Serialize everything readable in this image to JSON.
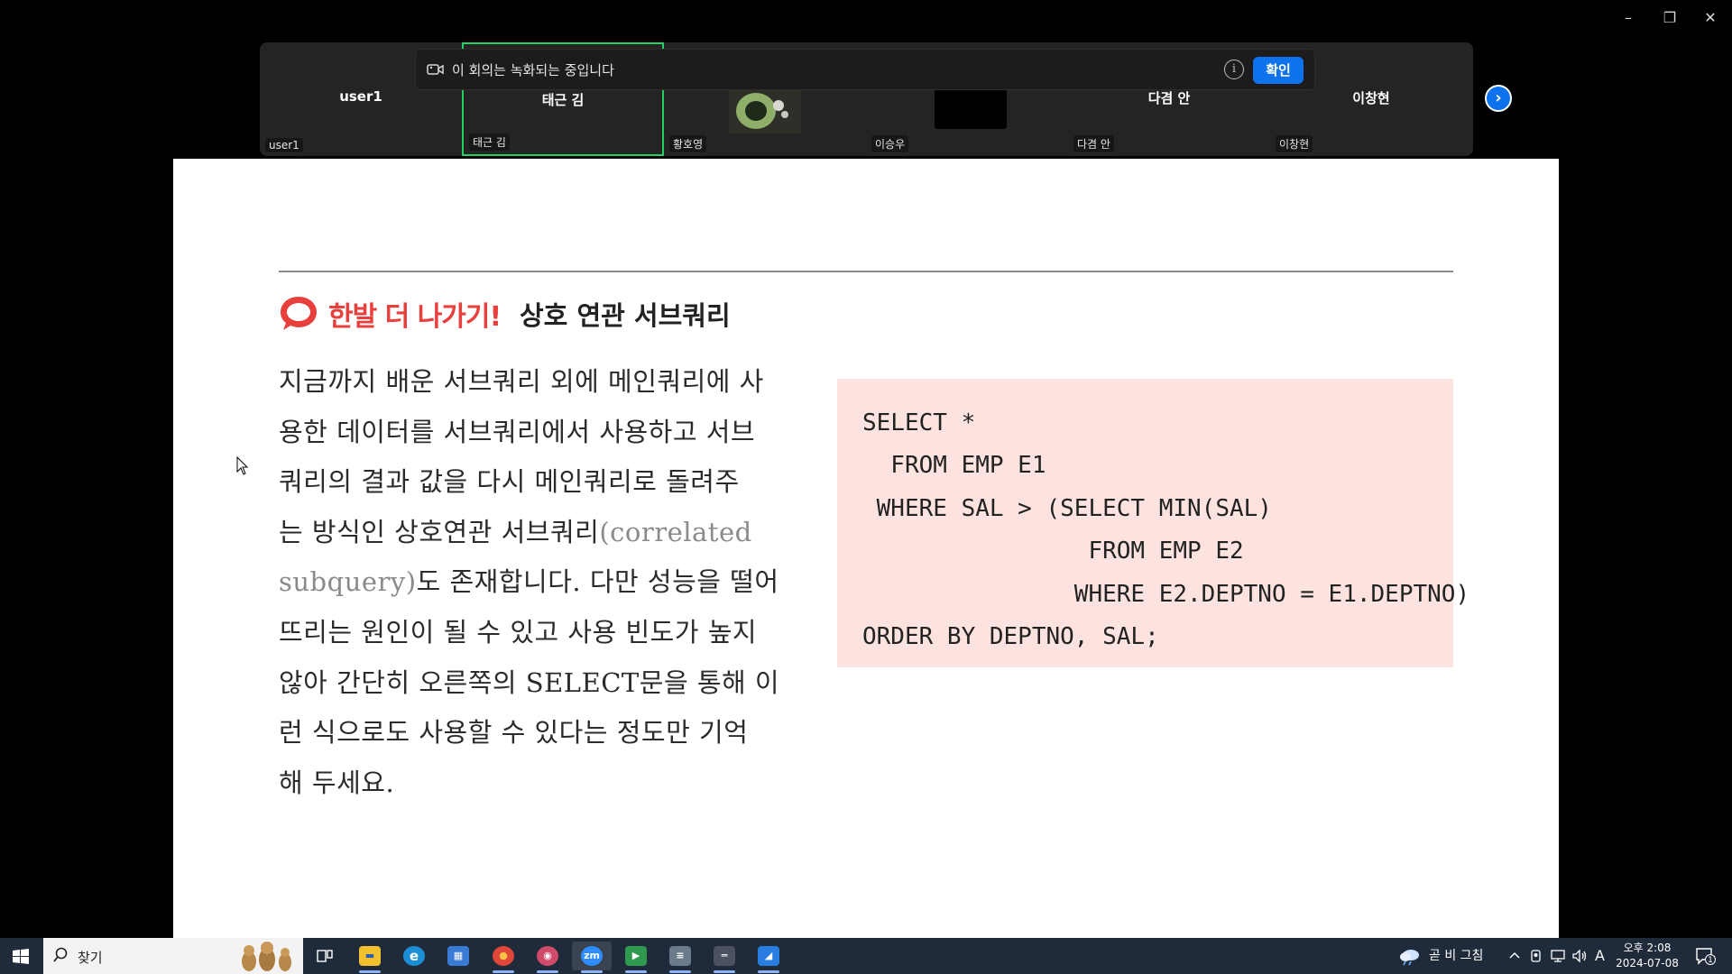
{
  "window": {
    "minimize": "–",
    "restore": "❐",
    "close": "✕"
  },
  "banner": {
    "message": "이 회의는 녹화되는 중입니다",
    "info": "i",
    "confirm": "확인"
  },
  "participants": [
    {
      "big": "user1",
      "small": "user1"
    },
    {
      "big": "태근 김",
      "small": "태근 김"
    },
    {
      "big": "",
      "small": "황호영"
    },
    {
      "big": "",
      "small": "이승우"
    },
    {
      "big": "다겸 안",
      "small": "다겸 안"
    },
    {
      "big": "이창현",
      "small": "이창현"
    }
  ],
  "next": "›",
  "slide": {
    "heading_highlight": "한발 더 나가기!",
    "heading_title": "상호 연관 서브쿼리",
    "lines": [
      {
        "ko": "지금까지 배운 서브쿼리 외에 메인쿼리에 사"
      },
      {
        "ko": "용한 데이터를 서브쿼리에서 사용하고 서브"
      },
      {
        "ko": "쿼리의 결과 값을 다시 메인쿼리로 돌려주"
      },
      {
        "ko": "는 방식인 상호연관 서브쿼리",
        "en": "(correlated"
      },
      {
        "en": "subquery)",
        "ko": "도 존재합니다. 다만 성능을 떨어"
      },
      {
        "ko": "뜨리는 원인이 될 수 있고 사용 빈도가 높지"
      },
      {
        "ko": "않아 간단히 오른쪽의 SELECT문을 통해 이"
      },
      {
        "ko": "런 식으로도 사용할 수 있다는 정도만 기억"
      },
      {
        "ko": "해 두세요."
      }
    ],
    "code": [
      "SELECT *",
      "  FROM EMP E1",
      " WHERE SAL > (SELECT MIN(SAL)",
      "                FROM EMP E2",
      "               WHERE E2.DEPTNO = E1.DEPTNO)",
      "ORDER BY DEPTNO, SAL;"
    ]
  },
  "taskbar": {
    "search_label": "찾기",
    "weather": "곧 비 그침",
    "ime": "A",
    "time": "오후 2:08",
    "date": "2024-07-08",
    "notifications": "1",
    "apps": [
      {
        "name": "task-view",
        "glyph": "▣",
        "color": "#1f2a3a"
      },
      {
        "name": "file-explorer",
        "glyph": "▬",
        "color": "#f2c12e"
      },
      {
        "name": "edge",
        "glyph": "e",
        "color": "#1b8fd6"
      },
      {
        "name": "store",
        "glyph": "▦",
        "color": "#3a7bd5"
      },
      {
        "name": "chrome",
        "glyph": "●",
        "color": "#e0463a"
      },
      {
        "name": "discord",
        "glyph": "◉",
        "color": "#d04a6a"
      },
      {
        "name": "zoom",
        "glyph": "zm",
        "color": "#2d8cff"
      },
      {
        "name": "media-app",
        "glyph": "▶",
        "color": "#2f9a4f"
      },
      {
        "name": "notepad-app",
        "glyph": "≡",
        "color": "#6b7b8c"
      },
      {
        "name": "terminal-app",
        "glyph": "═",
        "color": "#4a5160"
      },
      {
        "name": "paint-app",
        "glyph": "◢",
        "color": "#2a7de1"
      }
    ]
  }
}
